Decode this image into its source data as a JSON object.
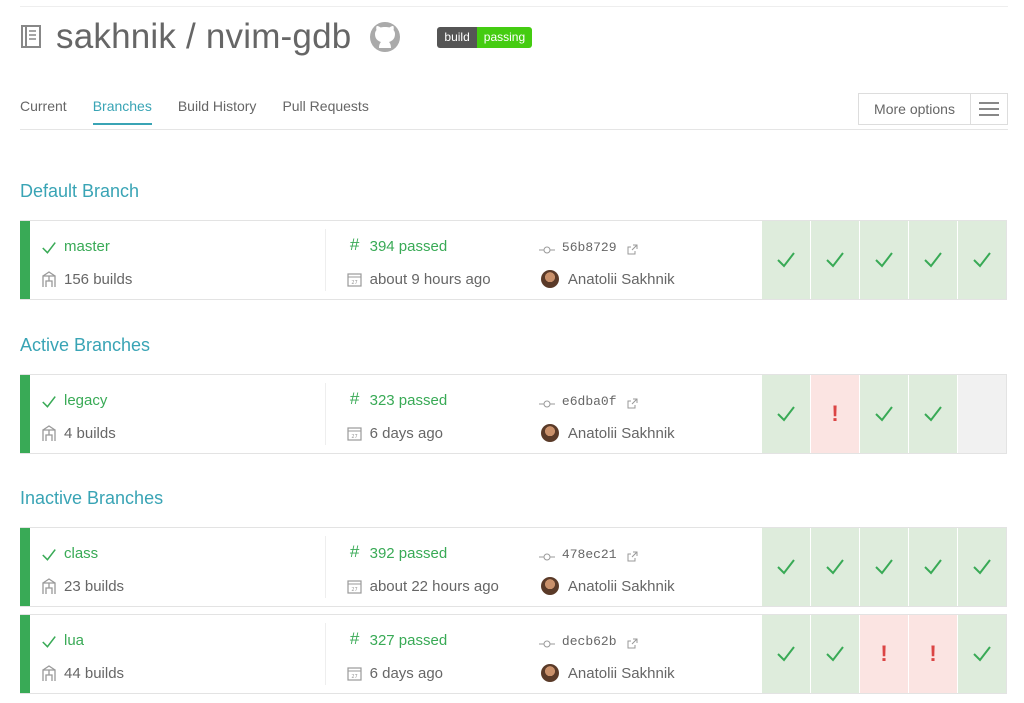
{
  "repo": {
    "owner": "sakhnik",
    "separator": " / ",
    "name": "nvim-gdb",
    "badge_left": "build",
    "badge_right": "passing"
  },
  "tabs": [
    "Current",
    "Branches",
    "Build History",
    "Pull Requests"
  ],
  "active_tab": "Branches",
  "more_options": "More options",
  "sections": {
    "default": "Default Branch",
    "active": "Active Branches",
    "inactive": "Inactive Branches"
  },
  "branches": [
    {
      "name": "master",
      "builds": "156 builds",
      "build": "394 passed",
      "time": "about 9 hours ago",
      "commit": "56b8729",
      "author": "Anatolii Sakhnik",
      "history": [
        "passed",
        "passed",
        "passed",
        "passed",
        "passed"
      ]
    },
    {
      "name": "legacy",
      "builds": "4 builds",
      "build": "323 passed",
      "time": "6 days ago",
      "commit": "e6dba0f",
      "author": "Anatolii Sakhnik",
      "history": [
        "passed",
        "failed",
        "passed",
        "passed",
        "empty"
      ]
    },
    {
      "name": "class",
      "builds": "23 builds",
      "build": "392 passed",
      "time": "about 22 hours ago",
      "commit": "478ec21",
      "author": "Anatolii Sakhnik",
      "history": [
        "passed",
        "passed",
        "passed",
        "passed",
        "passed"
      ]
    },
    {
      "name": "lua",
      "builds": "44 builds",
      "build": "327 passed",
      "time": "6 days ago",
      "commit": "decb62b",
      "author": "Anatolii Sakhnik",
      "history": [
        "passed",
        "passed",
        "failed",
        "failed",
        "passed"
      ]
    }
  ],
  "colors": {
    "accent": "#39a4b5",
    "passed": "#39aa56",
    "failed": "#db4545"
  }
}
